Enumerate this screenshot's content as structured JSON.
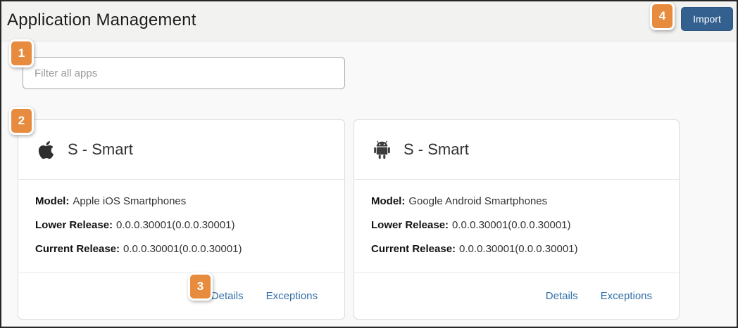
{
  "header": {
    "title": "Application Management",
    "import_label": "Import"
  },
  "filter": {
    "placeholder": "Filter all apps",
    "value": ""
  },
  "callouts": {
    "one": "1",
    "two": "2",
    "three": "3",
    "four": "4"
  },
  "cards": [
    {
      "icon": "apple-icon",
      "title": "S - Smart",
      "model_label": "Model:",
      "model_value": "Apple iOS Smartphones",
      "lower_release_label": "Lower Release:",
      "lower_release_value": "0.0.0.30001(0.0.0.30001)",
      "current_release_label": "Current Release:",
      "current_release_value": "0.0.0.30001(0.0.0.30001)",
      "details_label": "Details",
      "exceptions_label": "Exceptions"
    },
    {
      "icon": "android-icon",
      "title": "S - Smart",
      "model_label": "Model:",
      "model_value": "Google Android Smartphones",
      "lower_release_label": "Lower Release:",
      "lower_release_value": "0.0.0.30001(0.0.0.30001)",
      "current_release_label": "Current Release:",
      "current_release_value": "0.0.0.30001(0.0.0.30001)",
      "details_label": "Details",
      "exceptions_label": "Exceptions"
    }
  ],
  "colors": {
    "callout_orange": "#e78b3e",
    "import_button_blue": "#33608f",
    "link_blue": "#336fa6",
    "header_background": "#f2f2f1",
    "page_background": "#f9f9f9"
  }
}
